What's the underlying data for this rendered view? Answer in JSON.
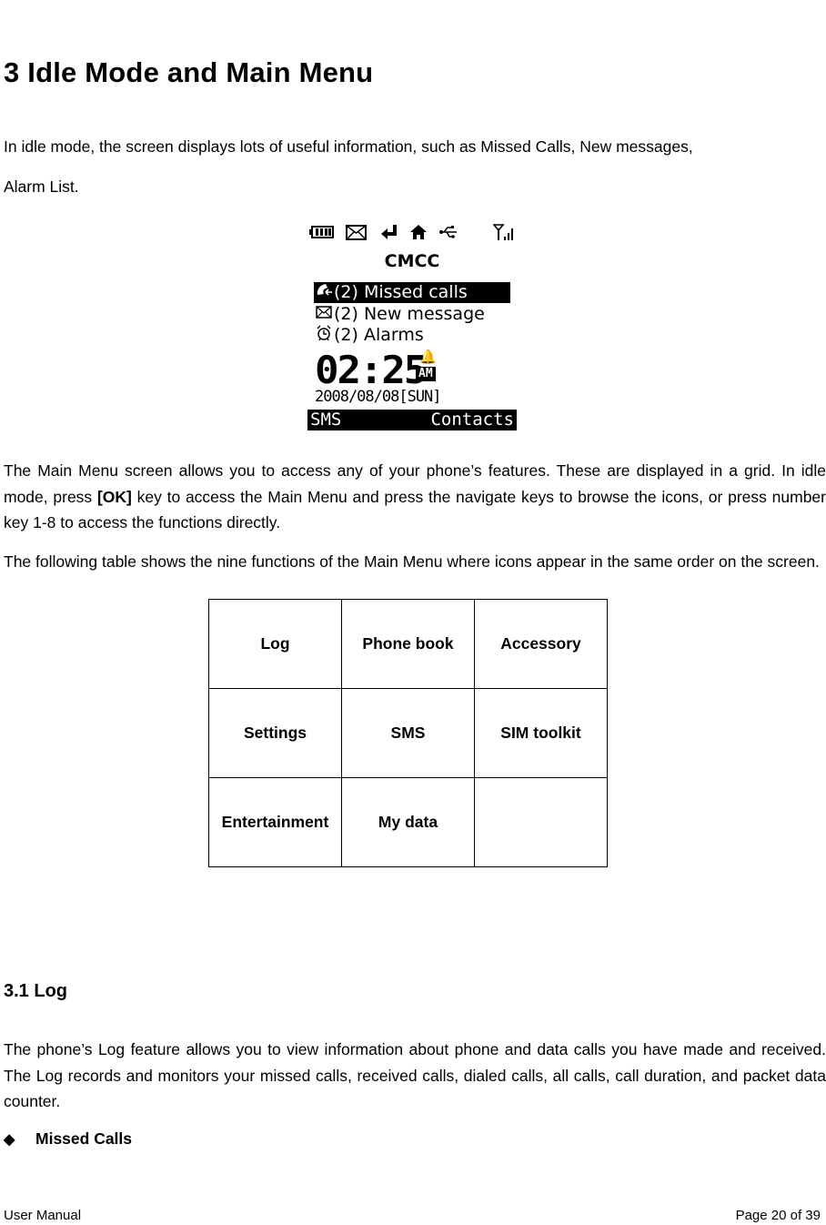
{
  "heading": "3 Idle Mode and Main Menu",
  "intro": {
    "line1": "In idle mode, the screen displays lots of useful information, such as Missed Calls, New messages,",
    "line2": "Alarm List."
  },
  "phone_screen": {
    "status_icons": [
      "battery-icon",
      "message-icon",
      "call-forward-icon",
      "home-zone-icon",
      "usb-icon",
      "signal-icon"
    ],
    "carrier": "CMCC",
    "notifications": [
      {
        "icon": "missed-call-icon",
        "text": "(2) Missed calls",
        "selected": true
      },
      {
        "icon": "envelope-icon",
        "text": "(2) New message",
        "selected": false
      },
      {
        "icon": "alarm-clock-icon",
        "text": "(2) Alarms",
        "selected": false
      }
    ],
    "time": "02:25",
    "ampm": "AM",
    "date": "2008/08/08[SUN]",
    "softkey_left": "SMS",
    "softkey_right": "Contacts"
  },
  "main_menu_para": {
    "before_bold": "The Main Menu screen allows you to access any of your phone’s features. These are displayed in a grid. In idle mode, press ",
    "bold": "[OK]",
    "after_bold": " key to access the Main Menu and press the navigate keys to browse the icons, or press number key 1-8 to access the functions directly."
  },
  "table_para": "The following table shows the nine functions of the Main Menu where icons appear in the same order on the screen.",
  "menu_table": [
    [
      "Log",
      "Phone book",
      "Accessory"
    ],
    [
      "Settings",
      "SMS",
      "SIM toolkit"
    ],
    [
      "Entertainment",
      "My data",
      ""
    ]
  ],
  "section": {
    "heading": "3.1 Log",
    "paragraph": "The phone’s Log feature allows you to view information about phone and data calls you have made and received. The Log records and monitors your missed calls, received calls, dialed calls, all calls, call duration, and packet data counter.",
    "bullet_symbol": "◆",
    "bullet": "Missed Calls"
  },
  "footer": {
    "left": "User Manual",
    "right": "Page 20 of 39"
  }
}
